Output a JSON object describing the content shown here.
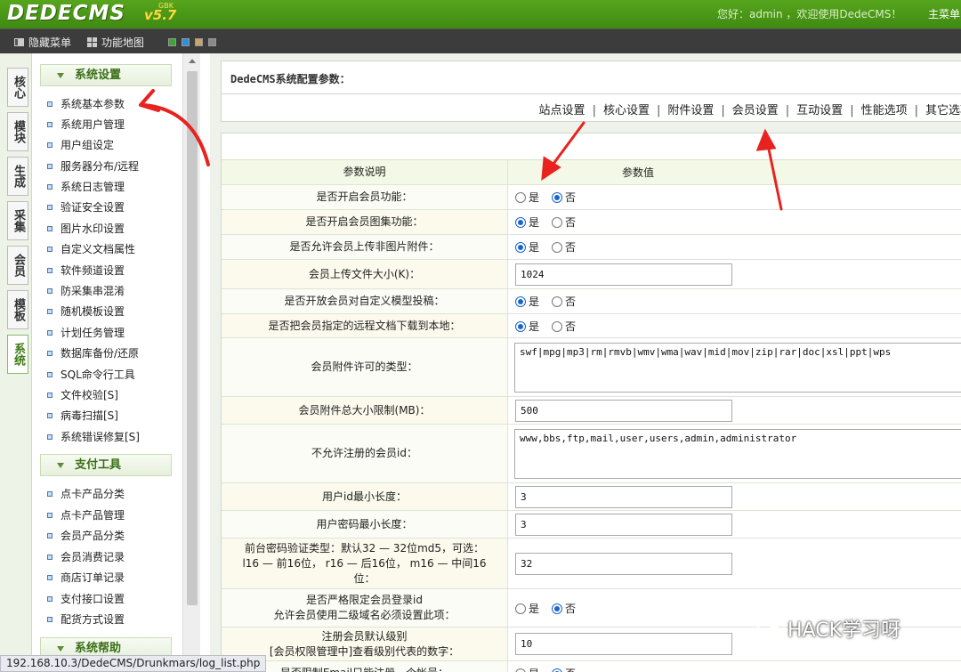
{
  "header": {
    "logo": "DEDECMS",
    "version": "v5.7",
    "version_tag": "GBK",
    "welcome": "您好：admin ，欢迎使用DedeCMS！",
    "main_menu": "主菜单"
  },
  "toolbar": {
    "hide_menu": "隐藏菜单",
    "func_map": "功能地图",
    "swatches": [
      "#3fa33a",
      "#2f8fd8",
      "#c9a46b",
      "#8a8a8a"
    ]
  },
  "vtabs": [
    "核心",
    "模块",
    "生成",
    "采集",
    "会员",
    "模板",
    "系统"
  ],
  "sidebar": {
    "group1": "系统设置",
    "items1": [
      "系统基本参数",
      "系统用户管理",
      "用户组设定",
      "服务器分布/远程",
      "系统日志管理",
      "验证安全设置",
      "图片水印设置",
      "自定义文档属性",
      "软件频道设置",
      "防采集串混淆",
      "随机模板设置",
      "计划任务管理",
      "数据库备份/还原",
      "SQL命令行工具",
      "文件校验[S]",
      "病毒扫描[S]",
      "系统错误修复[S]"
    ],
    "group2": "支付工具",
    "items2": [
      "点卡产品分类",
      "点卡产品管理",
      "会员产品分类",
      "会员消费记录",
      "商店订单记录",
      "支付接口设置",
      "配货方式设置"
    ],
    "group3": "系统帮助"
  },
  "main": {
    "title": "DedeCMS系统配置参数：",
    "tabs": [
      "站点设置",
      "核心设置",
      "附件设置",
      "会员设置",
      "互动设置",
      "性能选项",
      "其它选项"
    ],
    "col_desc": "参数说明",
    "col_value": "参数值",
    "yes": "是",
    "no": "否",
    "rows": [
      {
        "label": "是否开启会员功能：",
        "selected": "no"
      },
      {
        "label": "是否开启会员图集功能：",
        "selected": "yes"
      },
      {
        "label": "是否允许会员上传非图片附件：",
        "selected": "yes"
      },
      {
        "label": "会员上传文件大小(K)：",
        "value": "1024"
      },
      {
        "label": "是否开放会员对自定义模型投稿：",
        "selected": "yes"
      },
      {
        "label": "是否把会员指定的远程文档下载到本地：",
        "selected": "yes"
      },
      {
        "label": "会员附件许可的类型：",
        "value": "swf|mpg|mp3|rm|rmvb|wmv|wma|wav|mid|mov|zip|rar|doc|xsl|ppt|wps"
      },
      {
        "label": "会员附件总大小限制(MB)：",
        "value": "500"
      },
      {
        "label": "不允许注册的会员id：",
        "value": "www,bbs,ftp,mail,user,users,admin,administrator"
      },
      {
        "label": "用户id最小长度：",
        "value": "3"
      },
      {
        "label": "用户密码最小长度：",
        "value": "3"
      },
      {
        "label": "前台密码验证类型：默认32 — 32位md5，可选：",
        "label2": "l16 — 前16位， r16 — 后16位， m16 — 中间16",
        "label3": "位：",
        "value": "32"
      },
      {
        "label": "是否严格限定会员登录id",
        "label2": "允许会员使用二级域名必须设置此项：",
        "selected": "no"
      },
      {
        "label": "注册会员默认级别",
        "label2": "[会员权限管理中]查看级别代表的数字：",
        "value": "10"
      },
      {
        "label": "是否限制Email只能注册一个帐号：",
        "selected": "no"
      }
    ]
  },
  "watermark": "HACK学习呀",
  "status_url": "192.168.10.3/DedeCMS/Drunkmars/log_list.php"
}
